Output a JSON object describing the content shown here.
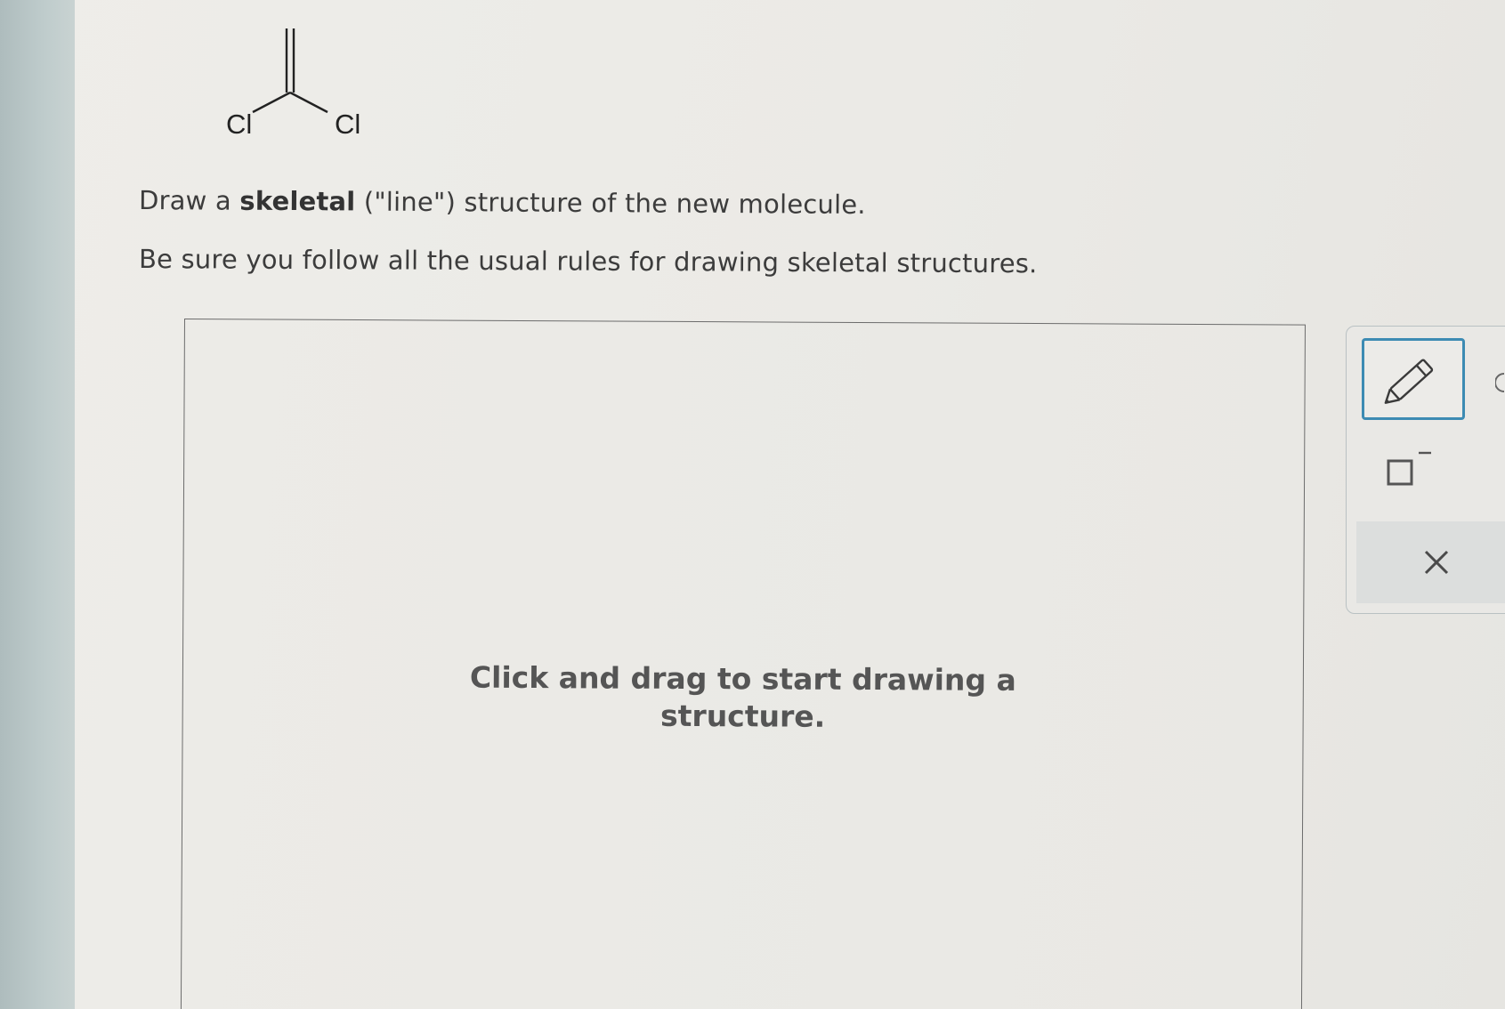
{
  "molecule": {
    "atom_left": "Cl",
    "atom_right": "Cl"
  },
  "instructions": {
    "line1_pre": "Draw a ",
    "line1_bold": "skeletal",
    "line1_post": " (\"line\") structure of the new molecule.",
    "line2": "Be sure you follow all the usual rules for drawing skeletal structures."
  },
  "canvas": {
    "hint_line1": "Click and drag to start drawing a",
    "hint_line2": "structure."
  },
  "toolbar": {
    "pencil_icon": "pencil-icon",
    "charge_icon": "charge-box-icon",
    "clear_icon": "close-icon",
    "accent_color": "#3d8bb3"
  }
}
